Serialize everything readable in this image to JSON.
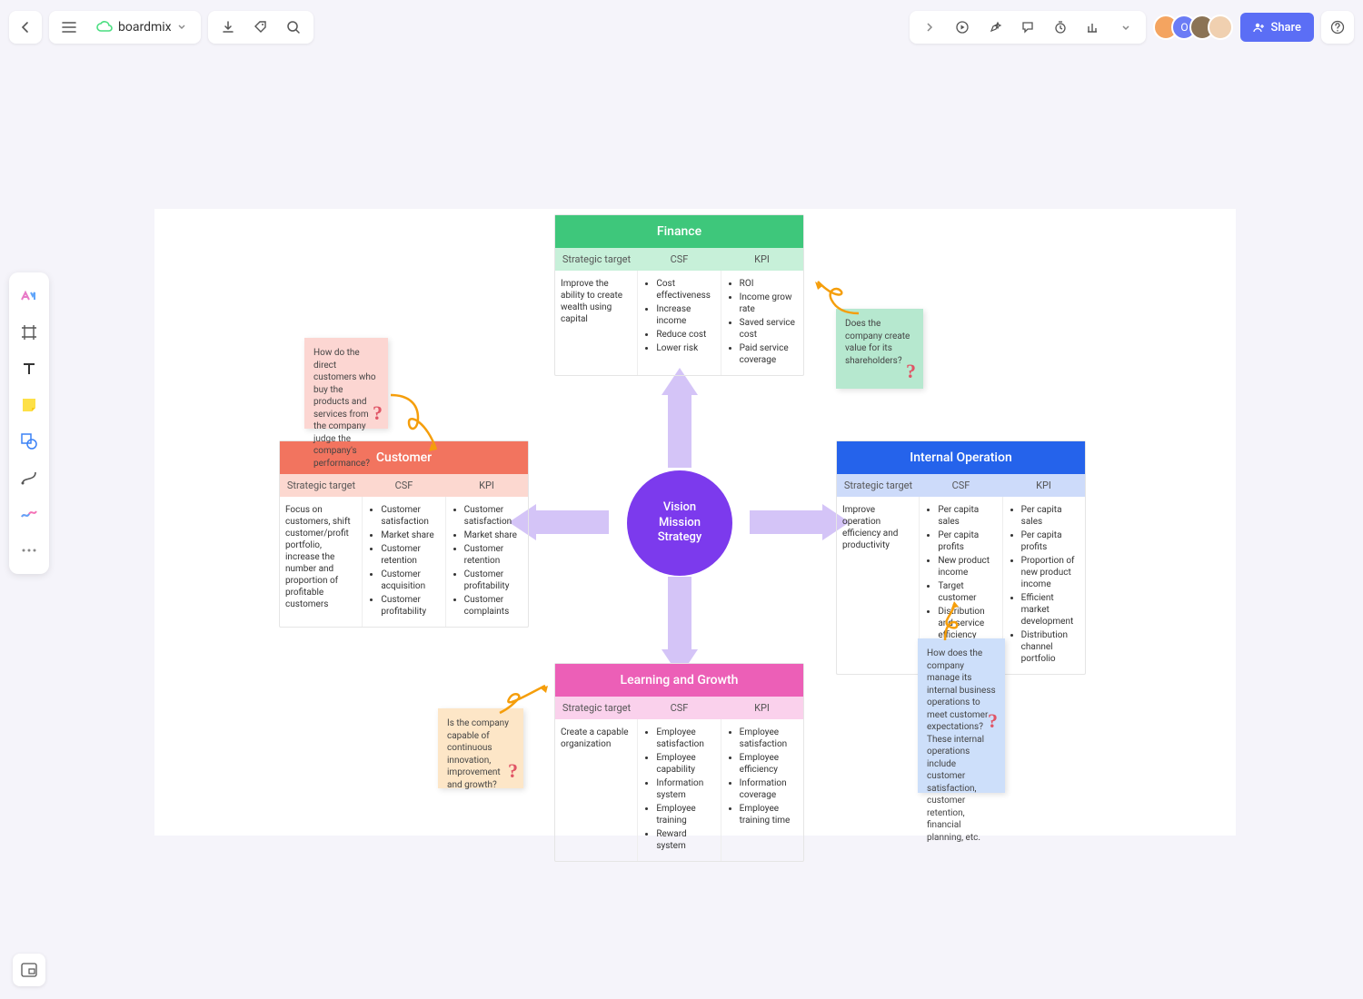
{
  "app": {
    "name": "boardmix"
  },
  "share": {
    "label": "Share"
  },
  "center": {
    "line1": "Vision",
    "line2": "Mission",
    "line3": "Strategy"
  },
  "columns": {
    "c1": "Strategic target",
    "c2": "CSF",
    "c3": "KPI"
  },
  "finance": {
    "title": "Finance",
    "target": "Improve the ability to create wealth using capital",
    "csf": [
      "Cost effectiveness",
      "Increase income",
      "Reduce cost",
      "Lower risk"
    ],
    "kpi": [
      "ROI",
      "Income grow rate",
      "Saved service cost",
      "Paid service coverage"
    ]
  },
  "customer": {
    "title": "Customer",
    "target": "Focus on customers, shift customer/profit portfolio, increase the number and proportion of profitable customers",
    "csf": [
      "Customer satisfaction",
      "Market share",
      "Customer retention",
      "Customer acquisition",
      "Customer profitability"
    ],
    "kpi": [
      "Customer satisfaction",
      "Market share",
      "Customer retention",
      "Customer profitability",
      "Customer complaints"
    ]
  },
  "internal": {
    "title": "Internal Operation",
    "target": "Improve operation efficiency and productivity",
    "csf": [
      "Per capita sales",
      "Per capita profits",
      "New product income",
      "Target customer",
      "Distribution and service efficiency"
    ],
    "kpi": [
      "Per capita sales",
      "Per capita profits",
      "Proportion of new product income",
      "Efficient market development",
      "Distribution channel portfolio"
    ]
  },
  "learning": {
    "title": "Learning and Growth",
    "target": "Create a capable organization",
    "csf": [
      "Employee satisfaction",
      "Employee capability",
      "Information system",
      "Employee training",
      "Reward system"
    ],
    "kpi": [
      "Employee satisfaction",
      "Employee efficiency",
      "Information coverage",
      "Employee training time"
    ]
  },
  "notes": {
    "finance": "Does the company create value for its shareholders?",
    "customer": "How do the direct customers who buy the products and services from the company judge the company's performance?",
    "internal": "How does the company manage its internal business operations to meet customer expectations? These internal operations include customer satisfaction, customer retention, financial planning, etc.",
    "learning": "Is the company capable of continuous innovation, improvement and growth?"
  }
}
